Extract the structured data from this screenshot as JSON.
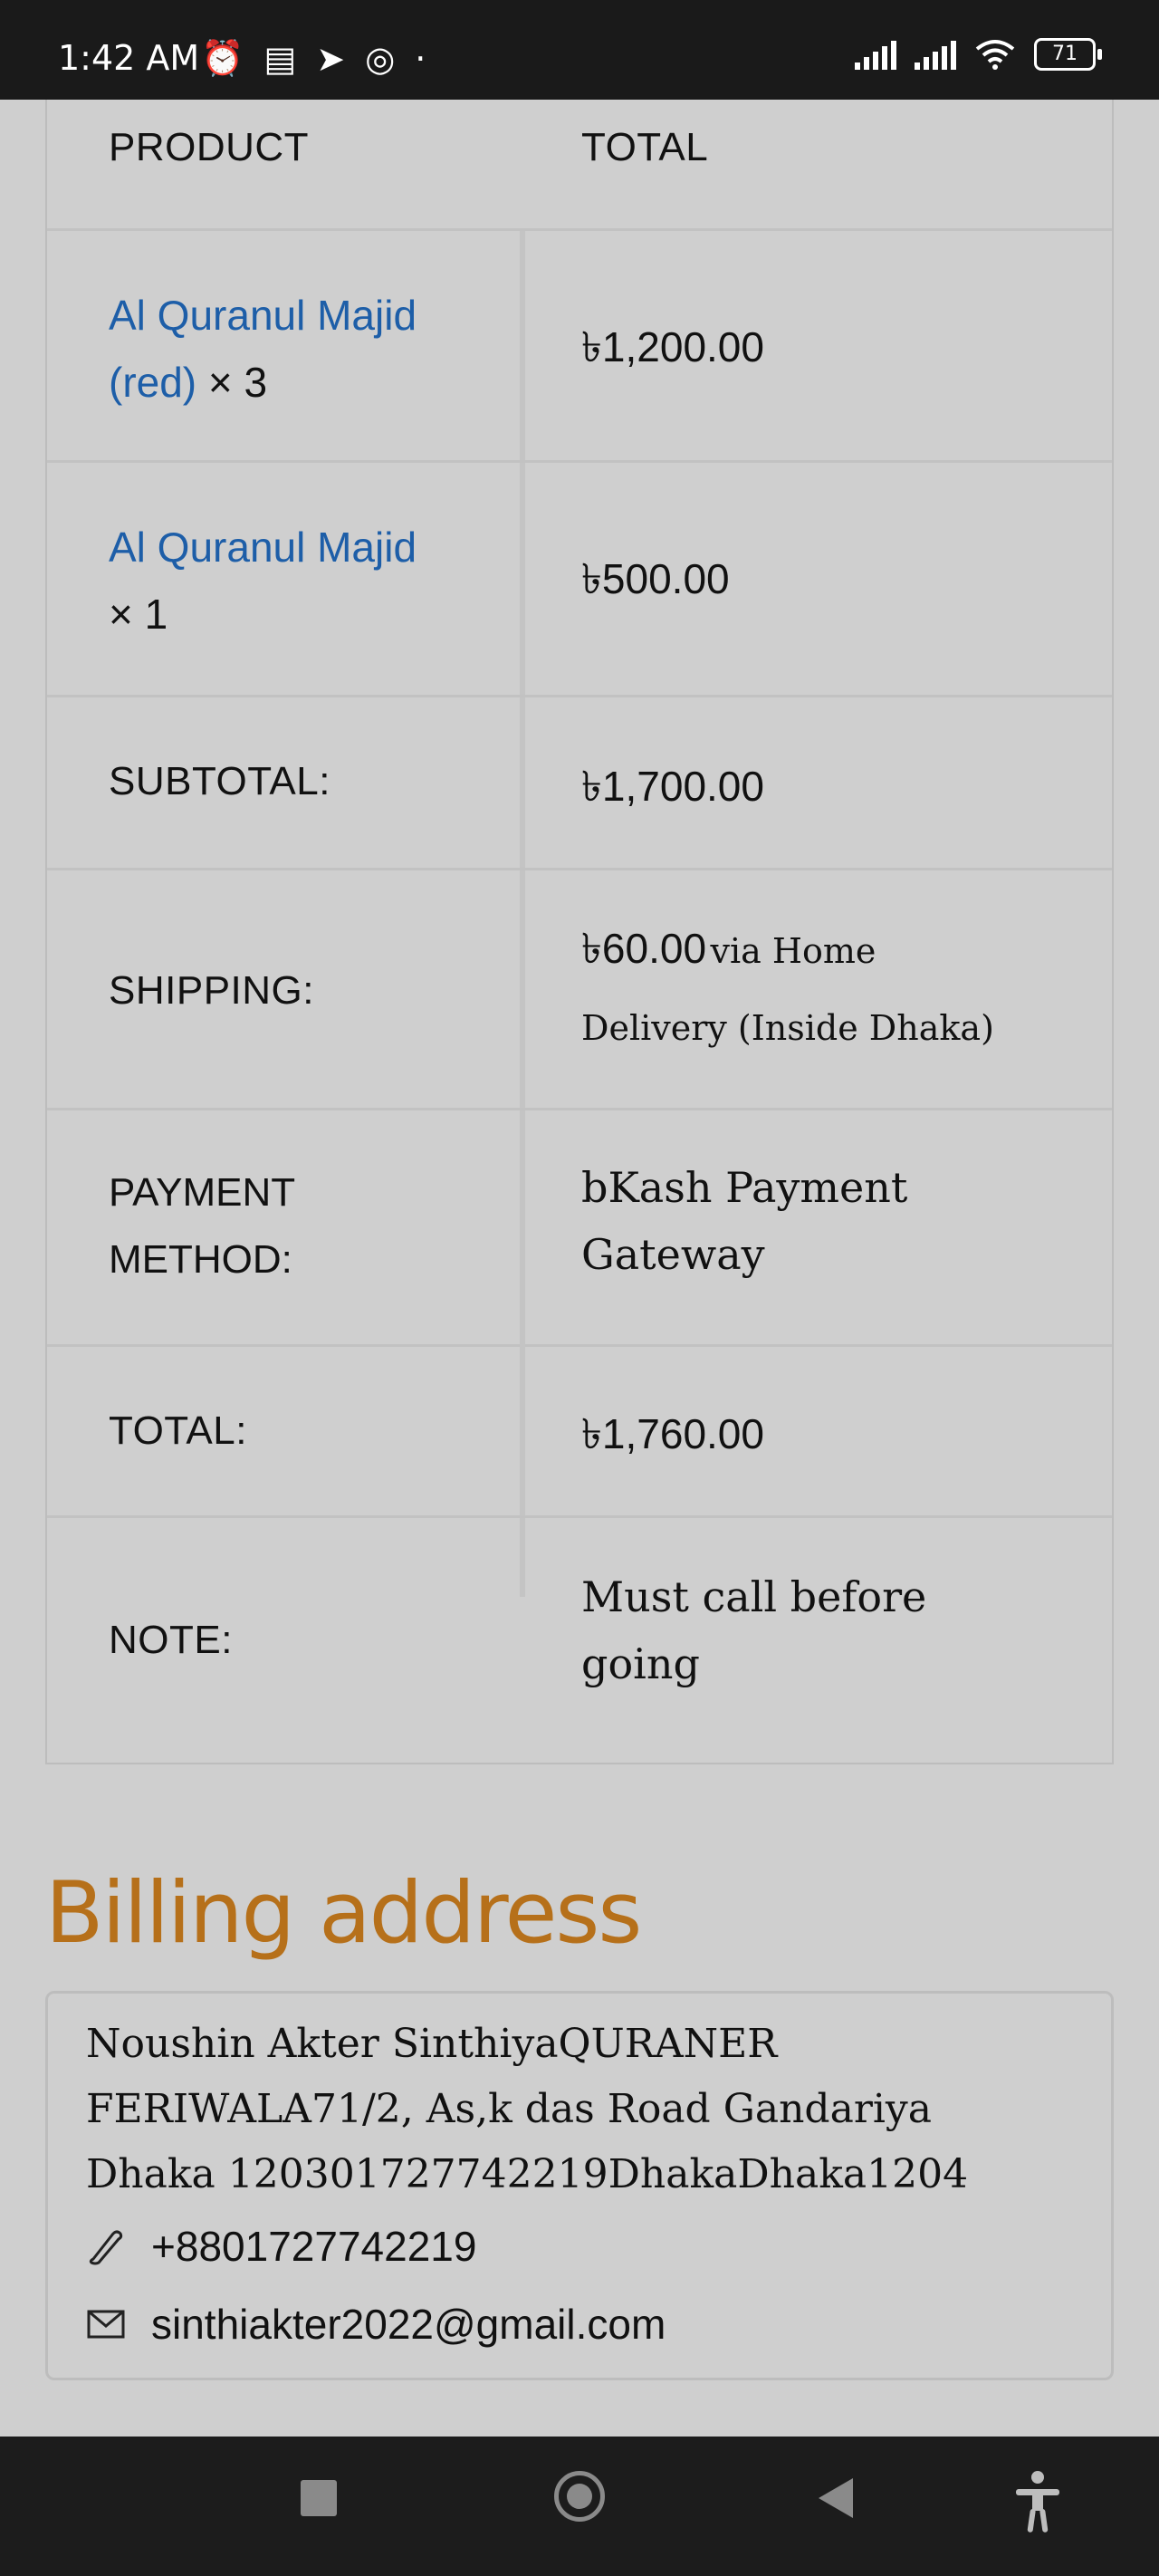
{
  "status_bar": {
    "time": "1:42 AM",
    "battery": "71"
  },
  "order": {
    "header": {
      "product": "PRODUCT",
      "total": "TOTAL"
    },
    "items": [
      {
        "name_line1": "Al Quranul Majid",
        "name_line2": "(red)",
        "qty": "× 3",
        "total": "৳1,200.00"
      },
      {
        "name_line1": "Al Quranul Majid",
        "qty": "× 1",
        "total": "৳500.00"
      }
    ],
    "subtotal_label": "SUBTOTAL:",
    "subtotal_value": "৳1,700.00",
    "shipping_label": "SHIPPING:",
    "shipping_amount": "৳60.00",
    "shipping_method_line1": "via Home",
    "shipping_method_line2": "Delivery (Inside Dhaka)",
    "payment_label_line1": "PAYMENT",
    "payment_label_line2": "METHOD:",
    "payment_value_line1": "bKash Payment",
    "payment_value_line2": "Gateway",
    "total_label": "TOTAL:",
    "total_value": "৳1,760.00",
    "note_label": "NOTE:",
    "note_line1": "Must call before",
    "note_line2": "going"
  },
  "billing": {
    "title": "Billing address",
    "address_line1": "Noushin Akter SinthiyaQURANER",
    "address_line2": "FERIWALA71/2, As,k das Road Gandariya",
    "address_line3": "Dhaka 120301727742219DhakaDhaka1204",
    "phone": "+8801727742219",
    "email": "sinthiakter2022@gmail.com"
  },
  "icons": [
    "phone-icon",
    "mail-icon",
    "wifi-icon",
    "battery-icon",
    "recent-apps-icon",
    "home-icon",
    "back-icon",
    "accessibility-icon"
  ]
}
